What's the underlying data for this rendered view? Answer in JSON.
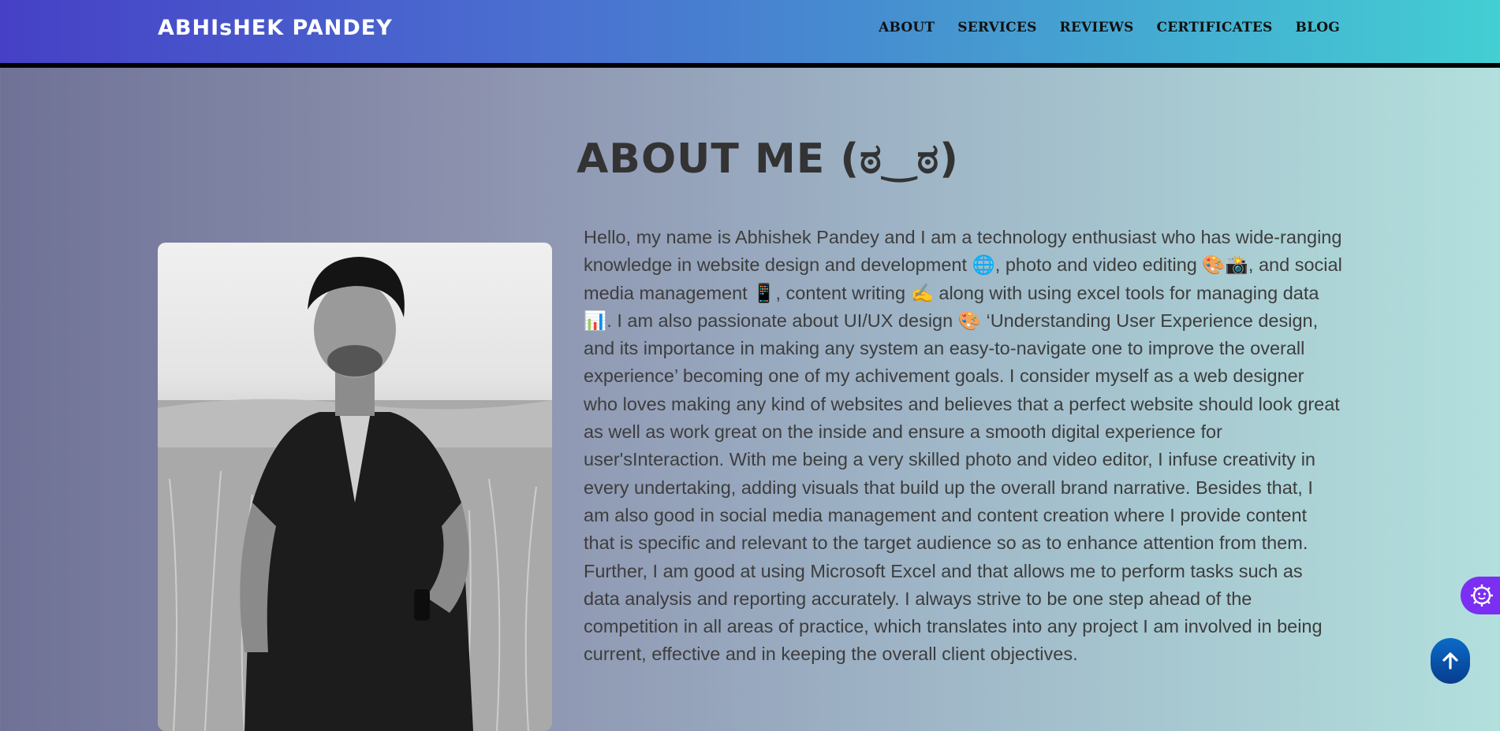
{
  "header": {
    "brand": "ABHIsHEK PANDEY",
    "nav": [
      {
        "label": "ABOUT"
      },
      {
        "label": "SERVICES"
      },
      {
        "label": "REVIEWS"
      },
      {
        "label": "CERTIFICATES"
      },
      {
        "label": "BLOG"
      }
    ]
  },
  "about": {
    "title": "ABOUT ME (ಠ‿ಠ)",
    "photo_alt": "Abhishek Pandey portrait",
    "bio": "Hello, my name is Abhishek Pandey and I am a technology enthusiast who has wide-ranging knowledge in website design and development 🌐, photo and video editing 🎨📸, and social media management 📱, content writing ✍️ along with using excel tools for managing data 📊. I am also passionate about UI/UX design 🎨 ‘Understanding User Experience design, and its importance in making any system an easy-to-navigate one to improve the overall experience’ becoming one of my achivement goals. I consider myself as a web designer who loves making any kind of websites and believes that a perfect website should look great as well as work great on the inside and ensure a smooth digital experience for user'sInteraction. With me being a very skilled photo and video editor, I infuse creativity in every undertaking, adding visuals that build up the overall brand narrative. Besides that, I am also good in social media management and content creation where I provide content that is specific and relevant to the target audience so as to enhance attention from them. Further, I am good at using Microsoft Excel and that allows me to perform tasks such as data analysis and reporting accurately. I always strive to be one step ahead of the competition in all areas of practice, which translates into any project I am involved in being current, effective and in keeping the overall client objectives."
  },
  "widgets": {
    "accessibility_icon": "accessibility-face-gear-icon",
    "scroll_top_icon": "arrow-up-icon",
    "accent": "#7b2ff2",
    "scroll_color": "#0a56b0"
  }
}
